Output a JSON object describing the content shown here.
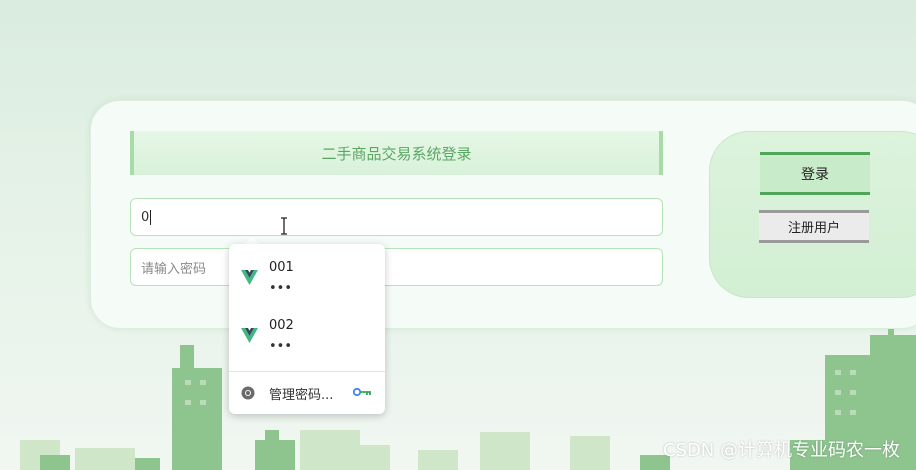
{
  "login": {
    "title": "二手商品交易系统登录",
    "username_value": "0",
    "password_placeholder": "请输入密码",
    "login_button": "登录",
    "register_button": "注册用户"
  },
  "autofill": {
    "items": [
      {
        "username": "001",
        "password_mask": "•••",
        "icon": "vue-logo-icon"
      },
      {
        "username": "002",
        "password_mask": "•••",
        "icon": "vue-logo-icon"
      }
    ],
    "manage_label": "管理密码...",
    "manage_icon": "chrome-icon",
    "key_icon": "key-icon"
  },
  "watermark": "CSDN @计算机专业码农一枚",
  "colors": {
    "accent_green": "#4fa65a",
    "title_text": "#5aa764",
    "city_green": "#7fbf80"
  }
}
